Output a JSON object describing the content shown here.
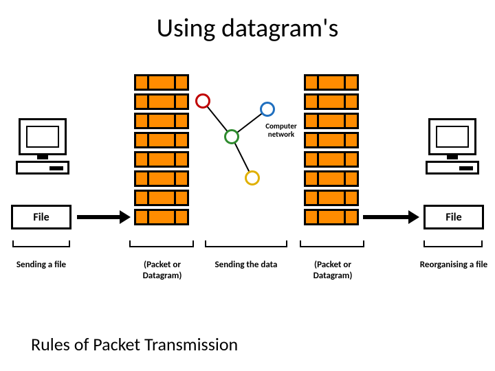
{
  "title": "Using datagram's",
  "subtitle": "Rules of Packet Transmission",
  "network_label": "Computer network",
  "file_label_left": "File",
  "file_label_right": "File",
  "captions": {
    "sending_file": "Sending a file",
    "packet_left": "(Packet or Datagram)",
    "sending_data": "Sending the data",
    "packet_right": "(Packet or Datagram)",
    "reorganising": "Reorganising a file"
  },
  "packet_rows": 8,
  "network_nodes": [
    {
      "name": "n1",
      "color": "#c00000"
    },
    {
      "name": "n2",
      "color": "#1f6fbf"
    },
    {
      "name": "n3",
      "color": "#2e8b2e"
    },
    {
      "name": "n4",
      "color": "#e0b000"
    }
  ]
}
